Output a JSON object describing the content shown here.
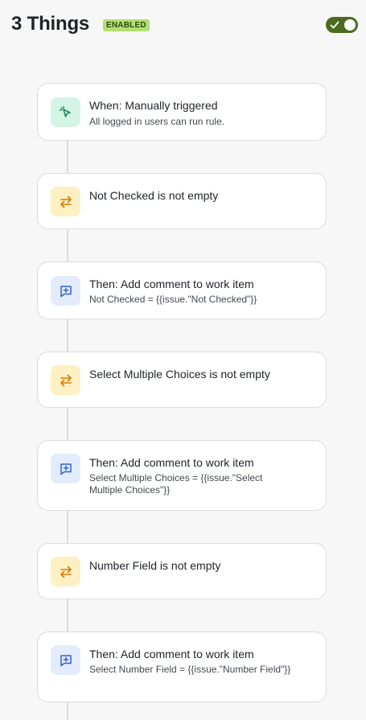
{
  "header": {
    "title": "3 Things",
    "status_badge": "ENABLED",
    "enabled": true
  },
  "colors": {
    "badge_bg": "#b3df72",
    "toggle_on": "#4c6b1f",
    "trigger_icon_bg": "#d4f5e6",
    "condition_icon_bg": "#fdf0c2",
    "action_icon_bg": "#e3ecfc"
  },
  "steps": [
    {
      "type": "trigger",
      "icon": "cursor-click-icon",
      "title": "When: Manually triggered",
      "subtitle": "All logged in users can run rule."
    },
    {
      "type": "condition",
      "icon": "swap-arrows-icon",
      "title": "Not Checked is not empty"
    },
    {
      "type": "action",
      "icon": "comment-add-icon",
      "title": "Then: Add comment to work item",
      "subtitle": "Not Checked = {{issue.\"Not Checked\"}}"
    },
    {
      "type": "condition",
      "icon": "swap-arrows-icon",
      "title": "Select Multiple Choices is not empty"
    },
    {
      "type": "action",
      "icon": "comment-add-icon",
      "title": "Then: Add comment to work item",
      "subtitle": "Select Multiple Choices = {{issue.\"Select Multiple Choices\"}}"
    },
    {
      "type": "condition",
      "icon": "swap-arrows-icon",
      "title": "Number Field is not empty"
    },
    {
      "type": "action",
      "icon": "comment-add-icon",
      "title": "Then: Add comment to work item",
      "subtitle": "Select Number Field = {{issue.\"Number Field\"}}"
    }
  ]
}
